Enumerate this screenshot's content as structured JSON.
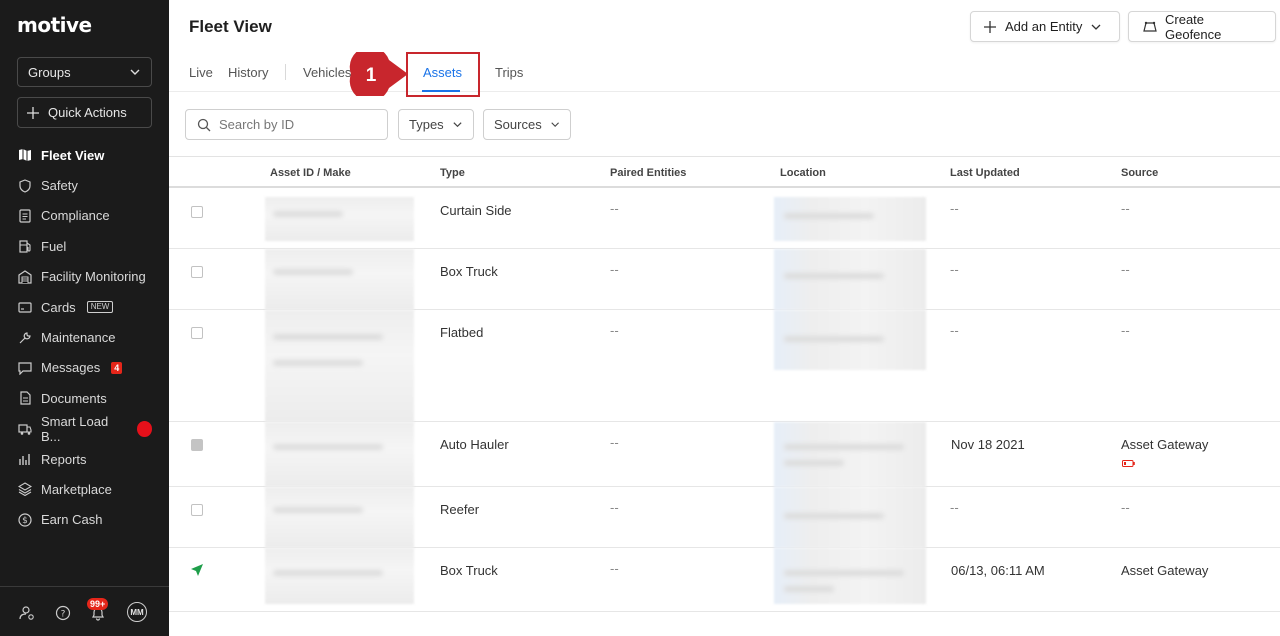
{
  "sidebar": {
    "logo": "motive",
    "groups_label": "Groups",
    "quick_actions_label": "Quick Actions",
    "items": [
      {
        "label": "Fleet View",
        "icon": "map-icon",
        "active": true
      },
      {
        "label": "Safety",
        "icon": "shield-icon"
      },
      {
        "label": "Compliance",
        "icon": "document-list-icon"
      },
      {
        "label": "Fuel",
        "icon": "fuel-pump-icon"
      },
      {
        "label": "Facility Monitoring",
        "icon": "warehouse-icon"
      },
      {
        "label": "Cards",
        "icon": "credit-card-icon",
        "badge": "NEW"
      },
      {
        "label": "Maintenance",
        "icon": "wrench-icon"
      },
      {
        "label": "Messages",
        "icon": "message-icon",
        "count": "4"
      },
      {
        "label": "Documents",
        "icon": "file-icon"
      },
      {
        "label": "Smart Load B...",
        "icon": "truck-box-icon"
      },
      {
        "label": "Reports",
        "icon": "bar-chart-icon"
      },
      {
        "label": "Marketplace",
        "icon": "layers-icon"
      },
      {
        "label": "Earn Cash",
        "icon": "dollar-icon"
      }
    ],
    "footer": {
      "notifications_count": "99+",
      "avatar_initials": "MM"
    }
  },
  "header": {
    "title": "Fleet View",
    "add_entity_label": "Add an Entity",
    "create_geofence_label": "Create Geofence"
  },
  "tabs": {
    "live": "Live",
    "history": "History",
    "vehicles": "Vehicles",
    "assets": "Assets",
    "trips": "Trips",
    "active": "Assets"
  },
  "annotation": {
    "step_number": "1",
    "color": "#c8262d"
  },
  "filters": {
    "search_placeholder": "Search by ID",
    "types_label": "Types",
    "sources_label": "Sources"
  },
  "table": {
    "columns": [
      "Asset ID / Make",
      "Type",
      "Paired Entities",
      "Location",
      "Last Updated",
      "Source"
    ],
    "rows": [
      {
        "type": "Curtain Side",
        "paired": "--",
        "last_updated": "--",
        "source": "--"
      },
      {
        "type": "Box Truck",
        "paired": "--",
        "last_updated": "--",
        "source": "--"
      },
      {
        "type": "Flatbed",
        "paired": "--",
        "last_updated": "--",
        "source": "--"
      },
      {
        "type": "Auto Hauler",
        "paired": "--",
        "last_updated": "Nov 18 2021",
        "source": "Asset Gateway"
      },
      {
        "type": "Reefer",
        "paired": "--",
        "last_updated": "--",
        "source": "--"
      },
      {
        "type": "Box Truck",
        "paired": "--",
        "last_updated": "06/13, 06:11 AM",
        "source": "Asset Gateway"
      }
    ]
  },
  "colors": {
    "accent": "#1a73e8",
    "sidebar_bg": "#1b1b1b",
    "alert_red": "#e5261a",
    "location_green": "#1e9e4a"
  }
}
